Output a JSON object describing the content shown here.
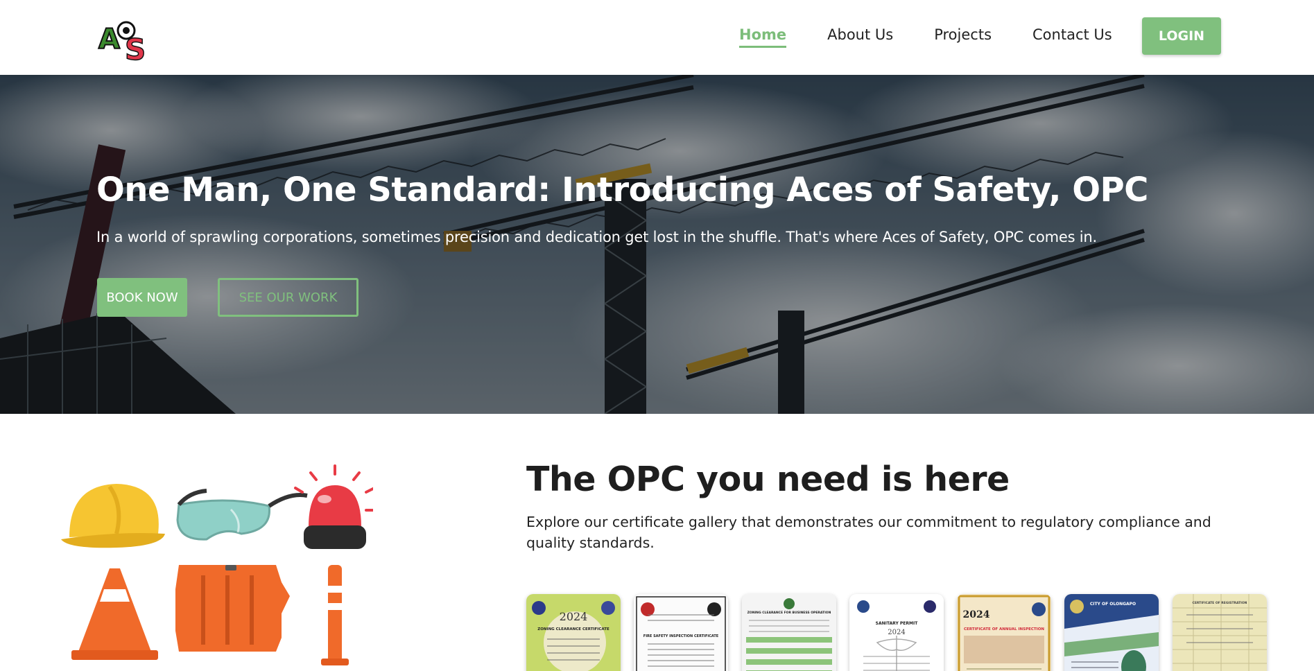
{
  "nav": {
    "logo_alt": "AOS",
    "links": [
      {
        "label": "Home",
        "active": true
      },
      {
        "label": "About Us",
        "active": false
      },
      {
        "label": "Projects",
        "active": false
      },
      {
        "label": "Contact Us",
        "active": false
      }
    ],
    "login_label": "LOGIN"
  },
  "hero": {
    "title": "One Man, One Standard: Introducing Aces of Safety, OPC",
    "subtitle": "In a world of sprawling corporations, sometimes precision and dedication get lost in the shuffle. That's where Aces of Safety, OPC comes in.",
    "book_label": "BOOK NOW",
    "work_label": "SEE OUR WORK"
  },
  "section": {
    "title": "The OPC you need is here",
    "description": "Explore our certificate gallery that demonstrates our commitment to regulatory compliance and quality standards."
  },
  "gallery": {
    "certificates": [
      {
        "year": "2024",
        "heading": "ZONING CLEARANCE CERTIFICATE"
      },
      {
        "year": "",
        "heading": "FIRE SAFETY INSPECTION CERTIFICATE"
      },
      {
        "year": "",
        "heading": "ZONING CLEARANCE FOR BUSINESS OPERATION"
      },
      {
        "year": "2024",
        "heading": "SANITARY PERMIT"
      },
      {
        "year": "2024",
        "heading": "CERTIFICATE OF ANNUAL INSPECTION"
      },
      {
        "year": "",
        "heading": "CITY OF OLONGAPO"
      },
      {
        "year": "",
        "heading": "CERTIFICATE OF REGISTRATION"
      }
    ]
  },
  "colors": {
    "accent": "#80c07e",
    "text_dark": "#1e1e1e"
  }
}
